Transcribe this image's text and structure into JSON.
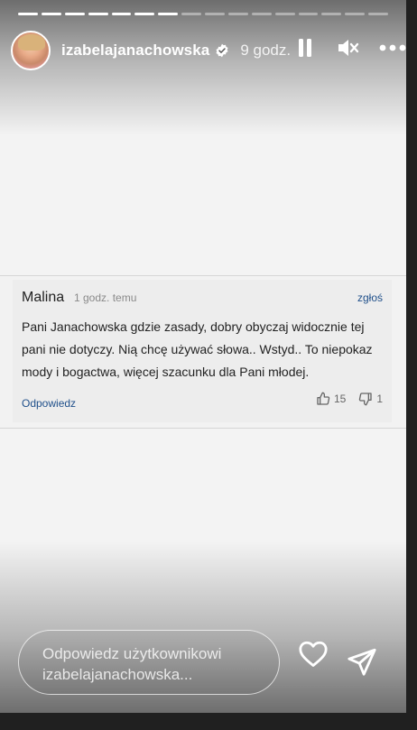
{
  "story": {
    "segments_total": 16,
    "segments_done": 7,
    "username": "izabelajanachowska",
    "time_ago": "9 godz.",
    "icons": {
      "verified": "verified-badge-icon",
      "pause": "pause-icon",
      "mute": "mute-icon",
      "more": "more-options-icon"
    }
  },
  "comment": {
    "author": "Malina",
    "time": "1 godz. temu",
    "report_label": "zgłoś",
    "text": "Pani Janachowska gdzie zasady, dobry obyczaj widocznie tej pani nie dotyczy. Nią chcę używać słowa.. Wstyd.. To niepokaz mody i bogactwa, więcej szacunku dla Pani młodej.",
    "reply_label": "Odpowiedz",
    "likes": "15",
    "dislikes": "1"
  },
  "reply_bar": {
    "placeholder": "Odpowiedz użytkownikowi izabelajanachowska..."
  },
  "colors": {
    "link_blue": "#1f4f8a",
    "card_bg": "#ededed"
  }
}
